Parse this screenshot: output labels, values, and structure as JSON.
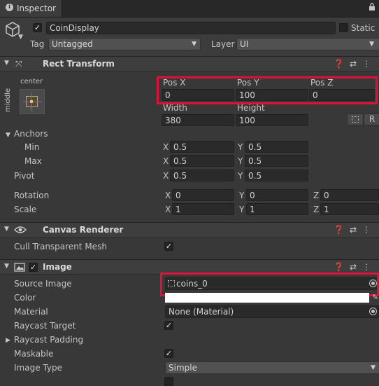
{
  "tab": {
    "label": "Inspector"
  },
  "object": {
    "name": "CoinDisplay",
    "static_label": "Static",
    "tag_label": "Tag",
    "tag_value": "Untagged",
    "layer_label": "Layer",
    "layer_value": "UI"
  },
  "rect_transform": {
    "title": "Rect Transform",
    "anchor_preset_top": "center",
    "anchor_preset_side": "middle",
    "pos_x_label": "Pos X",
    "pos_x": "0",
    "pos_y_label": "Pos Y",
    "pos_y": "100",
    "pos_z_label": "Pos Z",
    "pos_z": "0",
    "width_label": "Width",
    "width": "380",
    "height_label": "Height",
    "height": "100",
    "raw_button": "R",
    "anchors_label": "Anchors",
    "min_label": "Min",
    "min_x": "0.5",
    "min_y": "0.5",
    "max_label": "Max",
    "max_x": "0.5",
    "max_y": "0.5",
    "pivot_label": "Pivot",
    "pivot_x": "0.5",
    "pivot_y": "0.5",
    "rotation_label": "Rotation",
    "rot_x": "0",
    "rot_y": "0",
    "rot_z": "0",
    "scale_label": "Scale",
    "scale_x": "1",
    "scale_y": "1",
    "scale_z": "1",
    "axis_x": "X",
    "axis_y": "Y",
    "axis_z": "Z"
  },
  "canvas_renderer": {
    "title": "Canvas Renderer",
    "cull_label": "Cull Transparent Mesh"
  },
  "image": {
    "title": "Image",
    "source_label": "Source Image",
    "source_value": "coins_0",
    "color_label": "Color",
    "material_label": "Material",
    "material_value": "None (Material)",
    "raycast_target_label": "Raycast Target",
    "raycast_padding_label": "Raycast Padding",
    "maskable_label": "Maskable",
    "image_type_label": "Image Type",
    "image_type_value": "Simple"
  },
  "colors": {
    "background": "#383838",
    "header": "#3e3e3e",
    "field": "#2a2a2a",
    "highlight": "#e0103a"
  }
}
